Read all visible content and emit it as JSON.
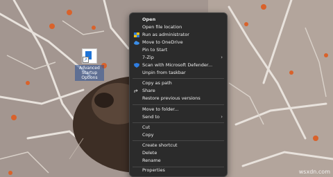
{
  "desktop": {
    "shortcut_label": "Advanced Startup Options"
  },
  "context_menu": {
    "items": [
      {
        "label": "Open",
        "bold": true
      },
      {
        "label": "Open file location"
      },
      {
        "label": "Run as administrator",
        "icon": "shield-icon"
      },
      {
        "label": "Move to OneDrive",
        "icon": "onedrive-cloud-icon"
      },
      {
        "label": "Pin to Start"
      },
      {
        "label": "7-Zip",
        "submenu": true
      },
      {
        "label": "Scan with Microsoft Defender...",
        "icon": "defender-shield-icon"
      },
      {
        "label": "Unpin from taskbar"
      },
      {
        "label": "Copy as path"
      },
      {
        "label": "Share",
        "icon": "share-icon"
      },
      {
        "label": "Restore previous versions"
      },
      {
        "label": "Move to folder..."
      },
      {
        "label": "Send to",
        "submenu": true
      },
      {
        "label": "Cut"
      },
      {
        "label": "Copy"
      },
      {
        "label": "Create shortcut"
      },
      {
        "label": "Delete"
      },
      {
        "label": "Rename"
      },
      {
        "label": "Properties"
      }
    ],
    "submenu_glyph": "›"
  },
  "watermark": "wsxdn.com",
  "colors": {
    "menu_bg": "#2b2b2b",
    "menu_text": "#f0f0f0",
    "separator": "#474747",
    "accent_blue": "#1e73d6"
  }
}
